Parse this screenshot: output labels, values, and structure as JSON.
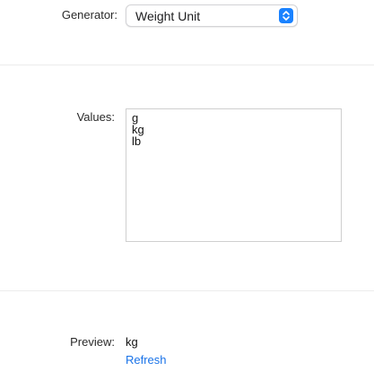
{
  "generator": {
    "label": "Generator:",
    "selected": "Weight Unit"
  },
  "values": {
    "label": "Values:",
    "items": [
      "g",
      "kg",
      "lb"
    ]
  },
  "preview": {
    "label": "Preview:",
    "value": "kg",
    "refresh_label": "Refresh"
  },
  "colors": {
    "accent": "#1a82ff",
    "link": "#1a73e8"
  }
}
